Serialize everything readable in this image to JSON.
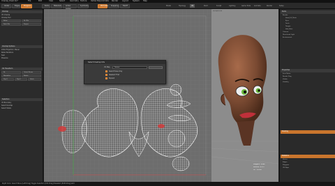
{
  "window_title": "Unwrap_Head.lxo*",
  "menubar": [
    "File",
    "Edit",
    "View",
    "Select",
    "Geometry",
    "Texture",
    "Vertex Map",
    "Animate",
    "Render",
    "Layout",
    "System",
    "Help"
  ],
  "layout_tabs": [
    "Model",
    "Topology",
    "UV",
    "Paint",
    "Sculpt",
    "Lighting",
    "Game Tools",
    "Animate",
    "Render",
    "Setup"
  ],
  "toolbar": {
    "buttons": [
      "Vertex",
      "Edges",
      "Polygons",
      "Items",
      "Materials",
      "Action Center",
      "Symmetry",
      "Workplane",
      "Snapping",
      "Falloff"
    ],
    "highlighted": "Polygons"
  },
  "left_panel": {
    "sections": [
      {
        "header": "Unwrap",
        "items": [
          "UV Unwrap",
          "Unwrap Tool",
          "Relax",
          "Fit UVs",
          "Pack UVs",
          "Project"
        ]
      },
      {
        "header": "Unwrap Options",
        "items": [
          "Initial Projection: Planar",
          "Relax Iterations",
          "Seal",
          "Preserve"
        ]
      },
      {
        "header": "UV Transform",
        "items": [
          "Fit",
          "Orient Pieces",
          "Normalize",
          "Rotate",
          "Flip U",
          "Flip V",
          "Stitch"
        ]
      },
      {
        "header": "Selection",
        "items": [
          "UV Boundary",
          "Select Overlap",
          "Select Shells"
        ]
      }
    ]
  },
  "dialog": {
    "title": "Select Overlap UVs",
    "field_label": "UV Map",
    "field_value": "Texture",
    "options": [
      "Select Faces Only",
      "Deselect First",
      "Expand"
    ]
  },
  "viewport_3d": {
    "label": "Perspective",
    "stats_lines": [
      "Polygons : 6,048",
      "Vertices : 6,112",
      "GL : 12,096"
    ]
  },
  "right_panel": {
    "sections": [
      {
        "header": "Items",
        "items": [
          "Render",
          "Head_UV_Mesh",
          "Eyes",
          "Teeth",
          "Tongue",
          "Hair_Base",
          "Camera",
          "Directional Light",
          "Environment"
        ]
      },
      {
        "header": "Properties",
        "items": [
          "Item Name",
          "Render Flag",
          "Visible",
          "Visibility"
        ]
      },
      {
        "header": "Shading",
        "items": []
      },
      {
        "header": "Statistics",
        "items": [
          "Vertex",
          "Edges",
          "Polygons",
          "UV Maps"
        ]
      }
    ]
  },
  "status": "Right Click: Select Menu  [Left Drag] Toggle Selection  [Ctrl-Drag] Deselect  [Shift-Drag] Add",
  "colors": {
    "accent": "#c9752d",
    "uv_bg": "#6d6d6d",
    "view_bg": "#8c8c8c",
    "skin": "#7a4a32",
    "eye_green": "#6ab83a",
    "overlap_red": "#d23a3a"
  }
}
